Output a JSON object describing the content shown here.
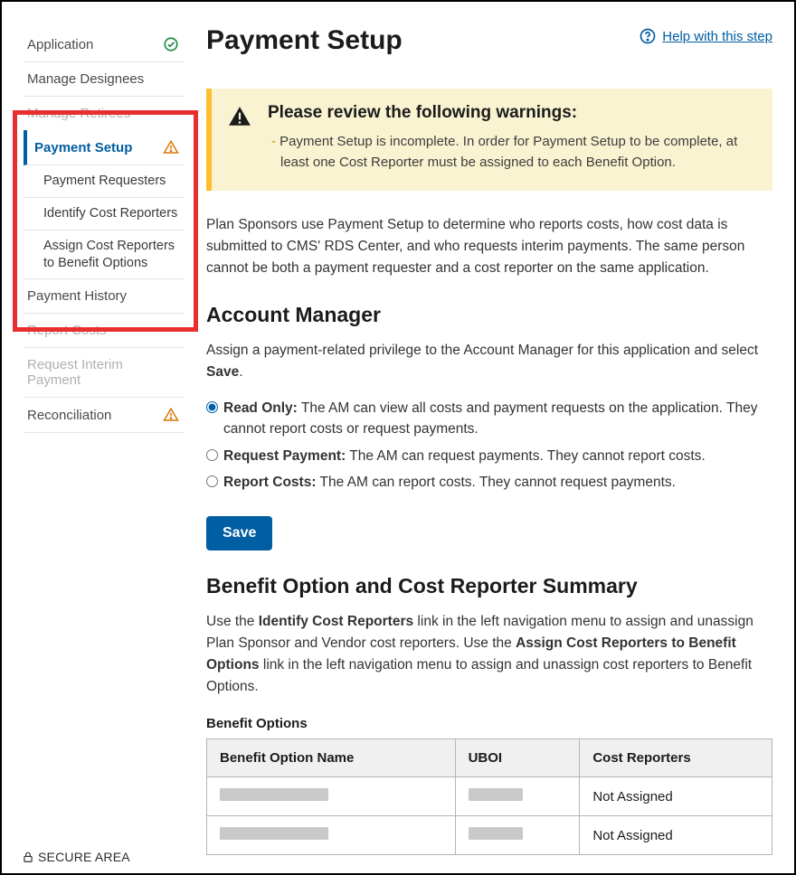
{
  "header": {
    "title": "Payment Setup",
    "help_label": "Help with this step"
  },
  "sidebar": {
    "items": {
      "application": "Application",
      "manage_designees": "Manage Designees",
      "manage_retirees": "Manage Retirees",
      "payment_setup": "Payment Setup",
      "payment_requesters": "Payment Requesters",
      "identify_cost_reporters": "Identify Cost Reporters",
      "assign_cost_reporters": "Assign Cost Reporters to Benefit Options",
      "payment_history": "Payment History",
      "report_costs": "Report Costs",
      "request_interim_payment": "Request Interim Payment",
      "reconciliation": "Reconciliation"
    }
  },
  "alert": {
    "title": "Please review the following warnings:",
    "body": "Payment Setup is incomplete. In order for Payment Setup to be complete, at least one Cost Reporter must be assigned to each Benefit Option."
  },
  "intro": "Plan Sponsors use Payment Setup to determine who reports costs, how cost data is submitted to CMS' RDS Center, and who requests interim payments. The same person cannot be both a payment requester and a cost reporter on the same application.",
  "account_manager": {
    "heading": "Account Manager",
    "desc_prefix": "Assign a payment-related privilege to the Account Manager for this application and select ",
    "desc_bold": "Save",
    "desc_suffix": ".",
    "options": {
      "read_only": {
        "label": "Read Only:",
        "desc": " The AM can view all costs and payment requests on the application. They cannot report costs or request payments."
      },
      "request_payment": {
        "label": "Request Payment:",
        "desc": " The AM can request payments. They cannot report costs."
      },
      "report_costs": {
        "label": "Report Costs:",
        "desc": " The AM can report costs. They cannot request payments."
      }
    },
    "save_label": "Save"
  },
  "summary": {
    "heading": "Benefit Option and Cost Reporter Summary",
    "p1_a": "Use the ",
    "p1_b": "Identify Cost Reporters",
    "p1_c": " link in the left navigation menu to assign and unassign Plan Sponsor and Vendor cost reporters. Use the ",
    "p1_d": "Assign Cost Reporters to Benefit Options",
    "p1_e": " link in the left navigation menu to assign and unassign cost reporters to Benefit Options.",
    "caption": "Benefit Options",
    "cols": {
      "name": "Benefit Option Name",
      "uboi": "UBOI",
      "reporters": "Cost Reporters"
    },
    "rows": [
      {
        "reporters": "Not Assigned"
      },
      {
        "reporters": "Not Assigned"
      }
    ]
  },
  "footer": "SECURE AREA"
}
